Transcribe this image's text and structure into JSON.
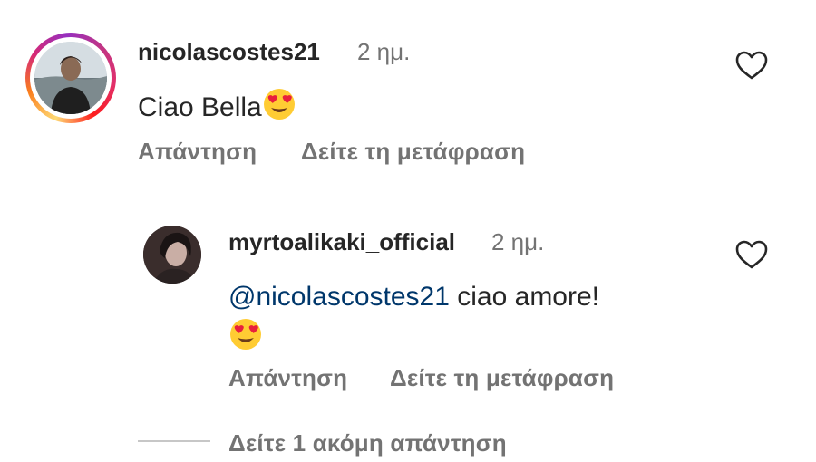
{
  "comment": {
    "username": "nicolascostes21",
    "time": "2 ημ.",
    "text": "Ciao Bella",
    "reply_label": "Απάντηση",
    "translate_label": "Δείτε τη μετάφραση"
  },
  "reply": {
    "username": "myrtoalikaki_official",
    "time": "2 ημ.",
    "mention": "@nicolascostes21",
    "text": "ciao amore!",
    "reply_label": "Απάντηση",
    "translate_label": "Δείτε τη μετάφραση"
  },
  "more_replies_label": "Δείτε 1 ακόμη απάντηση",
  "icons": {
    "like": "heart-outline-icon",
    "emoji": "heart-eyes-emoji"
  },
  "colors": {
    "text": "#262626",
    "secondary": "#737373",
    "mention": "#00376b"
  }
}
